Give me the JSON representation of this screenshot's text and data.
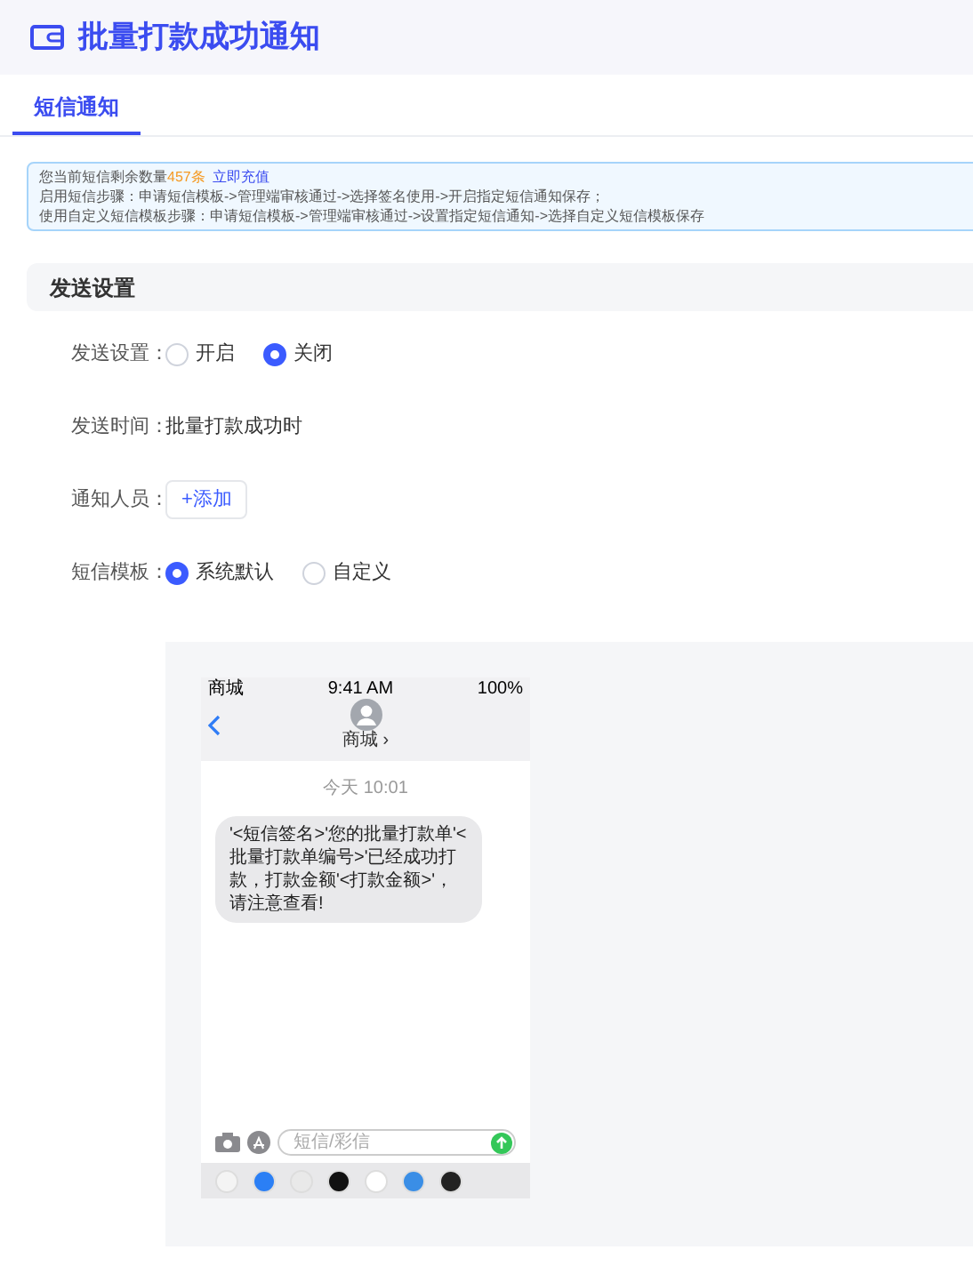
{
  "header": {
    "title": "批量打款成功通知"
  },
  "tabs": [
    {
      "label": "短信通知",
      "selected": true
    }
  ],
  "notice": {
    "prefix": "您当前短信剩余数量",
    "count": "457条",
    "link": "立即充值",
    "lines": [
      "启用短信步骤：申请短信模板->管理端审核通过->选择签名使用->开启指定短信通知保存；",
      "使用自定义短信模板步骤：申请短信模板->管理端审核通过->设置指定短信通知->选择自定义短信模板保存"
    ]
  },
  "section": {
    "title": "发送设置"
  },
  "form": [
    {
      "kind": "radio",
      "label": "发送设置：",
      "options": [
        {
          "label": "开启",
          "selected": false
        },
        {
          "label": "关闭",
          "selected": true
        }
      ]
    },
    {
      "kind": "text",
      "label": "发送时间：",
      "value": "批量打款成功时"
    },
    {
      "kind": "button",
      "label": "通知人员：",
      "button": "+添加"
    },
    {
      "kind": "radio",
      "label": "短信模板：",
      "options": [
        {
          "label": "系统默认",
          "selected": true
        },
        {
          "label": "自定义",
          "selected": false
        }
      ]
    }
  ],
  "phone": {
    "carrier": "商城",
    "time": "9:41 AM",
    "battery": "100%",
    "contact": "商城 ›",
    "timestamp": "今天 10:01",
    "message": "'<短信签名>'您的批量打款单'<批量打款单编号>'已经成功打款，打款金额'<打款金额>'，请注意查看!",
    "placeholder": "短信/彩信"
  }
}
